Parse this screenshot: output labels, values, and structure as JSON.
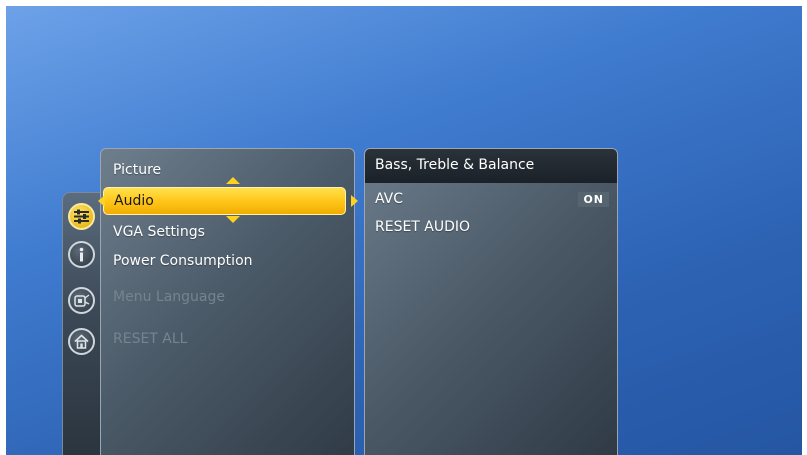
{
  "main_menu": {
    "items": [
      {
        "label": "Picture",
        "state": "normal"
      },
      {
        "label": "Audio",
        "state": "selected"
      },
      {
        "label": "VGA Settings",
        "state": "normal"
      },
      {
        "label": "Power Consumption",
        "state": "normal"
      },
      {
        "label": "Menu Language",
        "state": "disabled"
      },
      {
        "label": "RESET ALL",
        "state": "disabled"
      }
    ]
  },
  "sub_menu": {
    "title": "Bass, Treble & Balance",
    "items": [
      {
        "label": "AVC",
        "value": "ON"
      },
      {
        "label": "RESET AUDIO"
      }
    ]
  },
  "icon_rail": {
    "icons": [
      "settings-sliders-icon",
      "info-icon",
      "remote-control-icon",
      "home-icon"
    ]
  },
  "colors": {
    "background": "#3f7bcf",
    "highlight": "#ffc61a",
    "panel": "#4c5b69"
  }
}
